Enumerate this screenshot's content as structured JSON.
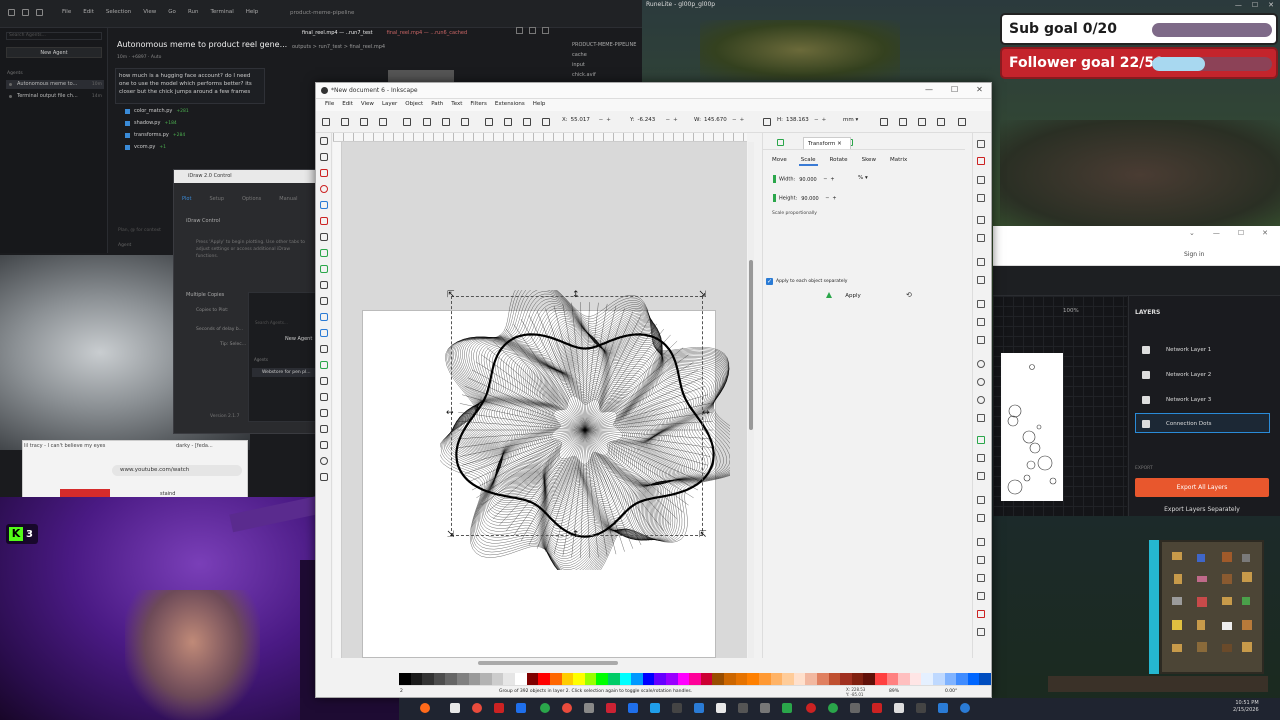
{
  "editor": {
    "menu": [
      "File",
      "Edit",
      "Selection",
      "View",
      "Go",
      "Run",
      "Terminal",
      "Help"
    ],
    "title": "product-meme-pipeline",
    "search_placeholder": "Search Agents...",
    "new_agent": "New Agent",
    "agents_label": "Agents",
    "agents": [
      {
        "label": "Autonomous meme to...",
        "time": "10m"
      },
      {
        "label": "Terminal output file ch...",
        "time": "14m"
      }
    ],
    "tabs": [
      "final_reel.mp4 — ..run7_test",
      "final_reel.mp4 — ...run6_cached"
    ],
    "outputs_path": "outputs > run7_test > final_reel.mp4",
    "sidetree": [
      "PRODUCT-MEME-PIPELINE",
      "cache",
      "input",
      "chick.avif"
    ],
    "chat_title": "Autonomous meme to product reel gene...",
    "chat_meta": "10m · +6897 · Auto",
    "chat_message": "how much is a hugging face account?  do I need one to use the model which performs better? its closer but the chick jumps around a few frames",
    "files": [
      {
        "name": "color_match.py",
        "diff": "+281"
      },
      {
        "name": "shadow.py",
        "diff": "+184"
      },
      {
        "name": "transforms.py",
        "diff": "+284"
      },
      {
        "name": "vcom.py",
        "diff": "+1"
      }
    ],
    "chat_input": "Plan, @ for context",
    "agent_mode": "Agent"
  },
  "game": {
    "title": "RuneLite - gl00p_gl00p"
  },
  "overlays": {
    "sub_goal": {
      "label": "Sub goal 0/20",
      "progress": 0.0
    },
    "follower_goal": {
      "label": "Follower goal 22/50",
      "progress": 0.44
    }
  },
  "layers_app": {
    "signin": "Sign in",
    "zoom": "100%",
    "heading": "LAYERS",
    "layers": [
      {
        "name": "Network Layer 1",
        "active": false
      },
      {
        "name": "Network Layer 2",
        "active": false
      },
      {
        "name": "Network Layer 3",
        "active": false
      },
      {
        "name": "Connection Dots",
        "active": true
      }
    ],
    "export_heading": "EXPORT",
    "export_all": "Export All Layers",
    "export_separately": "Export Layers Separately"
  },
  "idraw": {
    "title": "iDraw 2.0 Control",
    "tabs": [
      "Plot",
      "Setup",
      "Options",
      "Manual"
    ],
    "control": "iDraw Control",
    "note": "Press 'Apply' to begin plotting. Use other tabs to adjust settings or access additional iDraw functions.",
    "multi": "Multiple Copies",
    "copies": "Copies to Plot:",
    "seconds": "Seconds of delay b...",
    "tip": "Tip: Selec...",
    "version": "Version 2.1.7"
  },
  "mini_agents": {
    "search": "Search Agents...",
    "new_agent": "New Agent",
    "label": "Agents",
    "row": "Webstore for pen pl..."
  },
  "browser": {
    "tab1": "lil tracy - I can't believe my eyes",
    "tab2": "darky - [feda...",
    "url": "www.youtube.com/watch",
    "video_title": "staind"
  },
  "kick": {
    "count": "3"
  },
  "inkscape": {
    "title": "*New document 6 - Inkscape",
    "menu": [
      "File",
      "Edit",
      "View",
      "Layer",
      "Object",
      "Path",
      "Text",
      "Filters",
      "Extensions",
      "Help"
    ],
    "x_label": "X:",
    "x_value": "55.017",
    "y_label": "Y:",
    "y_value": "-6.243",
    "w_label": "W:",
    "w_value": "145.670",
    "h_label": "H:",
    "h_value": "138.163",
    "unit": "mm",
    "dock_tab": "Transform",
    "transform_tabs": [
      "Move",
      "Scale",
      "Rotate",
      "Skew",
      "Matrix"
    ],
    "active_transform_tab": "Scale",
    "width_label": "Width:",
    "width_value": "90.000",
    "height_label": "Height:",
    "height_value": "90.000",
    "scale_unit": "%",
    "scale_proportionally": "Scale proportionally",
    "apply_each": "Apply to each object separately",
    "apply": "Apply",
    "status_message": "Group of 392 objects in layer 2. Click selection again to toggle scale/rotation handles.",
    "status_coords_x": "X: 228.53",
    "status_coords_y": "Y: -85.01",
    "status_zoom": "89%",
    "status_rotation": "0.00°",
    "status_layer": "2"
  },
  "palette": [
    "#000000",
    "#1a1a1a",
    "#333333",
    "#4d4d4d",
    "#666666",
    "#808080",
    "#999999",
    "#b3b3b3",
    "#cccccc",
    "#e6e6e6",
    "#ffffff",
    "#800000",
    "#ff0000",
    "#ff6600",
    "#ffcc00",
    "#ffff00",
    "#99ff00",
    "#00ff00",
    "#00cc66",
    "#00ffff",
    "#0099ff",
    "#0000ff",
    "#6600ff",
    "#9900ff",
    "#ff00ff",
    "#ff0099",
    "#cc0033",
    "#994d00",
    "#cc6600",
    "#e67300",
    "#ff8000",
    "#ff9933",
    "#ffb366",
    "#ffcc99",
    "#ffe0cc",
    "#f2b8a0",
    "#e08060",
    "#c05030",
    "#a03020",
    "#802010",
    "#601008",
    "#ff4040",
    "#ff8080",
    "#ffbfbf",
    "#ffe5e5",
    "#e5f0ff",
    "#bfd9ff",
    "#80b3ff",
    "#408cff",
    "#0066ff",
    "#004dbf"
  ],
  "clock": {
    "time": "10:51 PM",
    "date": "2/15/2026"
  }
}
